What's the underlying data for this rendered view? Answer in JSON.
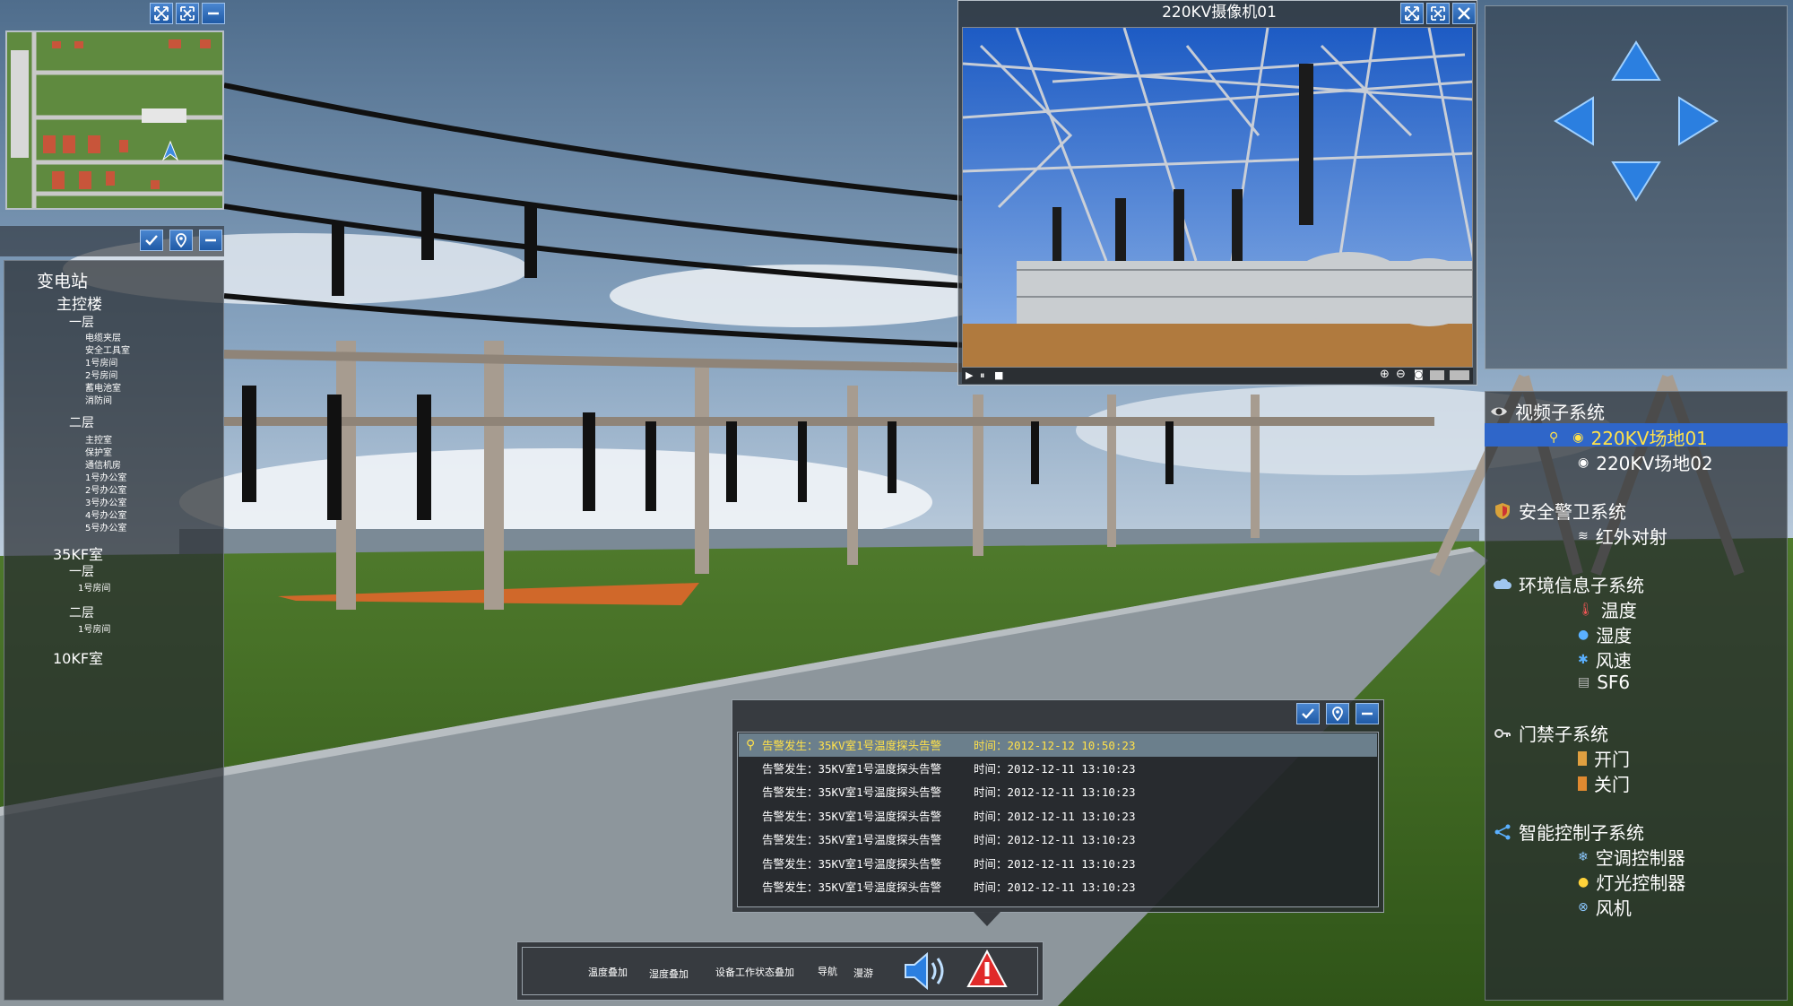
{
  "minimap": {
    "buttons": [
      "expand-icon",
      "fullscreen-icon",
      "minimize-icon"
    ]
  },
  "tree": {
    "root": "变电站",
    "main_building": "主控楼",
    "floor1": "一层",
    "floor1_rooms": [
      "电缆夹层",
      "安全工具室",
      "1号房间",
      "2号房间",
      "蓄电池室",
      "消防间"
    ],
    "floor2": "二层",
    "floor2_rooms": [
      "主控室",
      "保护室",
      "通信机房",
      "1号办公室",
      "2号办公室",
      "3号办公室",
      "4号办公室",
      "5号办公室"
    ],
    "room35": "35KF室",
    "room35_floor1": "一层",
    "room35_floor1_rooms": [
      "1号房间"
    ],
    "room35_floor2": "二层",
    "room35_floor2_rooms": [
      "1号房间"
    ],
    "room10": "10KF室"
  },
  "camera": {
    "title": "220KV摄像机01"
  },
  "subsystems": {
    "video": {
      "label": "视频子系统",
      "items": [
        "220KV场地01",
        "220KV场地02"
      ],
      "selected": 0
    },
    "security": {
      "label": "安全警卫系统",
      "items": [
        "红外对射"
      ]
    },
    "environment": {
      "label": "环境信息子系统",
      "items": [
        "温度",
        "湿度",
        "风速",
        "SF6"
      ]
    },
    "access": {
      "label": "门禁子系统",
      "items": [
        "开门",
        "关门"
      ]
    },
    "smart": {
      "label": "智能控制子系统",
      "items": [
        "空调控制器",
        "灯光控制器",
        "风机"
      ]
    }
  },
  "alarms": [
    {
      "msg": "告警发生：35KV室1号温度探头告警",
      "time": "时间：2012-12-12 10:50:23",
      "highlight": true
    },
    {
      "msg": "告警发生：35KV室1号温度探头告警",
      "time": "时间：2012-12-11 13:10:23"
    },
    {
      "msg": "告警发生：35KV室1号温度探头告警",
      "time": "时间：2012-12-11 13:10:23"
    },
    {
      "msg": "告警发生：35KV室1号温度探头告警",
      "time": "时间：2012-12-11 13:10:23"
    },
    {
      "msg": "告警发生：35KV室1号温度探头告警",
      "time": "时间：2012-12-11 13:10:23"
    },
    {
      "msg": "告警发生：35KV室1号温度探头告警",
      "time": "时间：2012-12-11 13:10:23"
    },
    {
      "msg": "告警发生：35KV室1号温度探头告警",
      "time": "时间：2012-12-11 13:10:23"
    }
  ],
  "toolbar": {
    "items": [
      "温度叠加",
      "湿度叠加",
      "设备工作状态叠加",
      "导航",
      "漫游"
    ]
  },
  "colors": {
    "accent": "#1f5aa6",
    "selected_text": "#ffe14a",
    "alarm_highlight": "#ffe14a"
  }
}
